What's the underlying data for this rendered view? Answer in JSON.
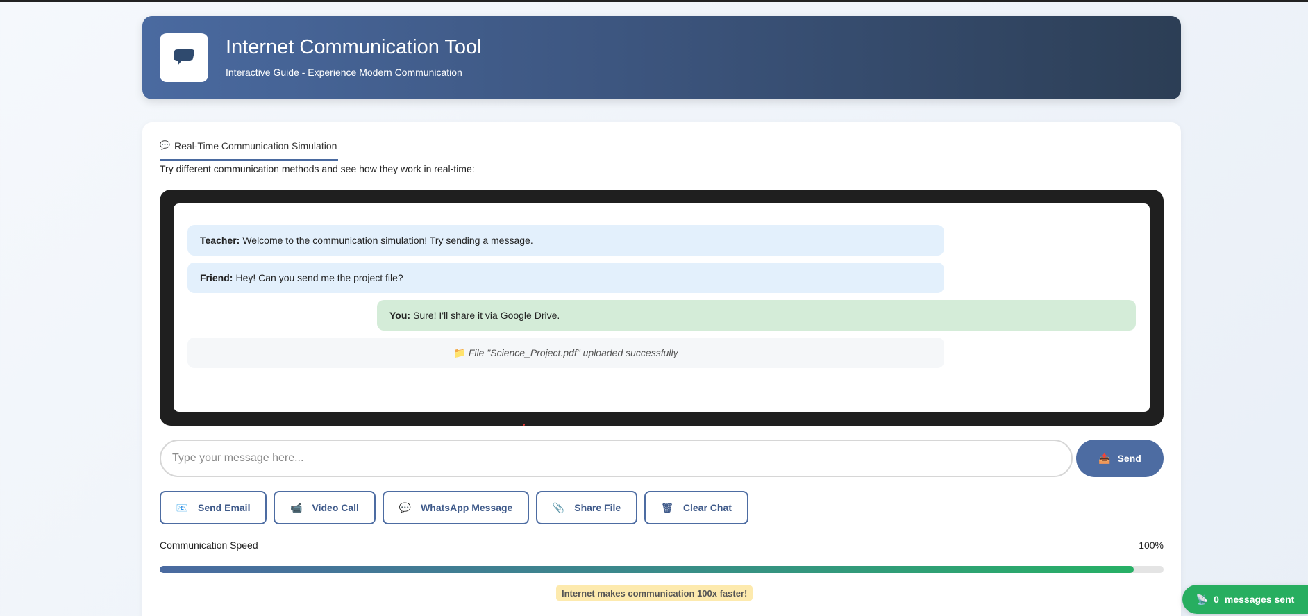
{
  "header": {
    "title": "Internet Communication Tool",
    "subtitle": "Interactive Guide - Experience Modern Communication",
    "logo_icon": "speech-bubble-icon"
  },
  "tab": {
    "icon": "💬",
    "label": "Real-Time Communication Simulation"
  },
  "instructions": "Try different communication methods and see how they work in real-time:",
  "chat": {
    "messages": [
      {
        "sender": "Teacher:",
        "text": "Welcome to the communication simulation! Try sending a message.",
        "type": "incoming"
      },
      {
        "sender": "Friend:",
        "text": "Hey! Can you send me the project file?",
        "type": "incoming"
      },
      {
        "sender": "You:",
        "text": "Sure! I'll share it via Google Drive.",
        "type": "outgoing"
      },
      {
        "icon": "📁",
        "text": "File \"Science_Project.pdf\" uploaded successfully",
        "type": "system"
      }
    ]
  },
  "composer": {
    "placeholder": "Type your message here...",
    "send_icon": "📤",
    "send_label": "Send"
  },
  "actions": [
    {
      "icon": "📧",
      "label": "Send Email"
    },
    {
      "icon": "📹",
      "label": "Video Call"
    },
    {
      "icon": "💬",
      "label": "WhatsApp Message"
    },
    {
      "icon": "📎",
      "label": "Share File"
    },
    {
      "icon": "🗑",
      "label": "Clear Chat"
    }
  ],
  "speed": {
    "label": "Communication Speed",
    "value_text": "100%",
    "fill_fraction": 0.97
  },
  "tip": "Internet makes communication 100x faster!",
  "counter": {
    "icon": "📡",
    "count": "0",
    "label": "messages sent"
  },
  "colors": {
    "accent": "#4d6ca2",
    "incoming_bg": "#e3f0fc",
    "outgoing_bg": "#d4ecd8",
    "counter_bg": "#27ae60",
    "tip_bg": "#fdeaae"
  }
}
